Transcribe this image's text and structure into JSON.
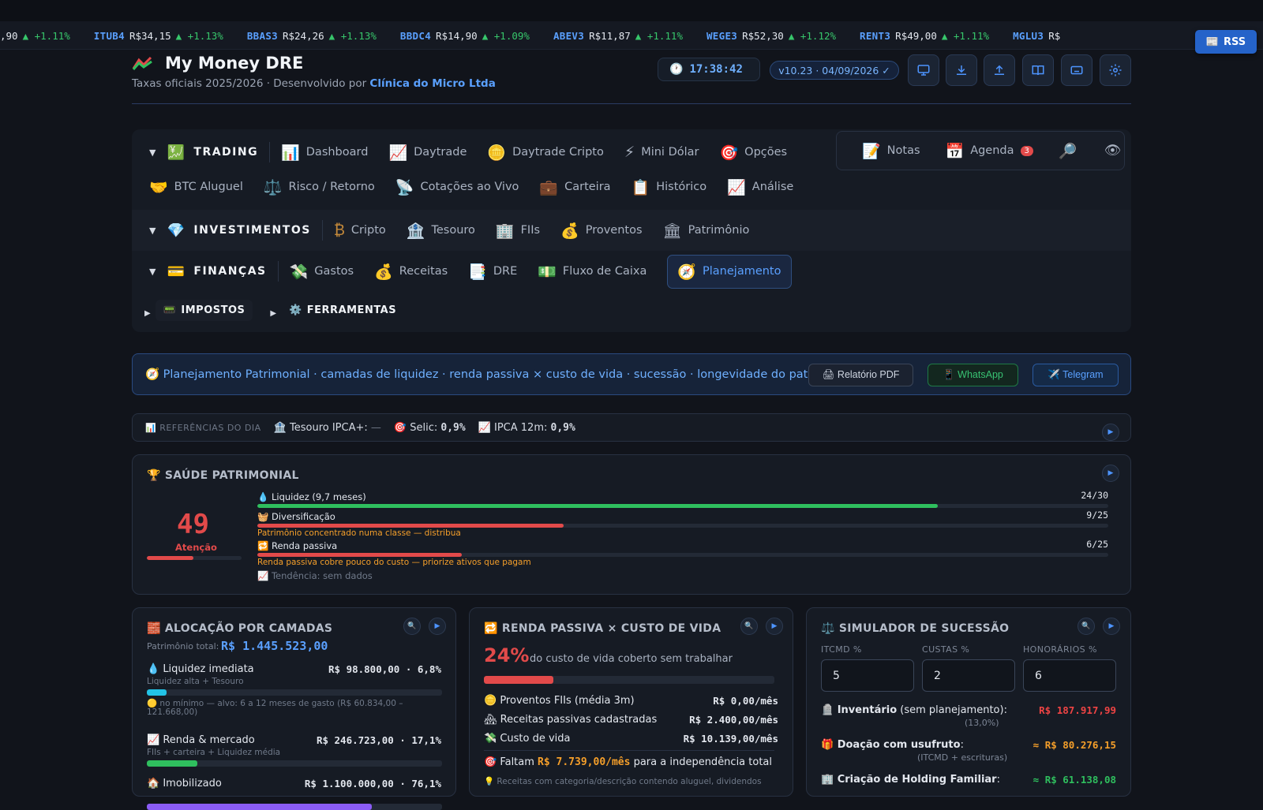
{
  "ticker": [
    {
      "sym": "",
      "price": ",90",
      "change": "▲ +1.11%"
    },
    {
      "sym": "ITUB4",
      "price": "R$34,15",
      "change": "▲ +1.13%"
    },
    {
      "sym": "BBAS3",
      "price": "R$24,26",
      "change": "▲ +1.13%"
    },
    {
      "sym": "BBDC4",
      "price": "R$14,90",
      "change": "▲ +1.09%"
    },
    {
      "sym": "ABEV3",
      "price": "R$11,87",
      "change": "▲ +1.11%"
    },
    {
      "sym": "WEGE3",
      "price": "R$52,30",
      "change": "▲ +1.12%"
    },
    {
      "sym": "RENT3",
      "price": "R$49,00",
      "change": "▲ +1.11%"
    },
    {
      "sym": "MGLU3",
      "price": "R$",
      "change": ""
    }
  ],
  "rss_label": "RSS",
  "header": {
    "title": "My Money DRE",
    "subtitle_prefix": "Taxas oficiais 2025/2026 · Desenvolvido por ",
    "subtitle_company": "Clínica do Micro Ltda",
    "clock": "17:38:42",
    "version": "v10.23 · 04/09/2026 ✓"
  },
  "nav": {
    "trading": {
      "label": "TRADING",
      "items": [
        "Dashboard",
        "Daytrade",
        "Daytrade Cripto",
        "Mini Dólar",
        "Opções",
        "BTC Aluguel",
        "Risco / Retorno",
        "Cotações ao Vivo",
        "Carteira",
        "Histórico",
        "Análise"
      ]
    },
    "investimentos": {
      "label": "INVESTIMENTOS",
      "items": [
        "Cripto",
        "Tesouro",
        "FIIs",
        "Proventos",
        "Patrimônio"
      ]
    },
    "financas": {
      "label": "FINANÇAS",
      "items": [
        "Gastos",
        "Receitas",
        "DRE",
        "Fluxo de Caixa",
        "Planejamento"
      ]
    },
    "impostos": "IMPOSTOS",
    "ferramentas": "FERRAMENTAS",
    "quick": {
      "notas": "Notas",
      "agenda": "Agenda",
      "agenda_badge": "3"
    }
  },
  "banner": {
    "text": "🧭 Planejamento Patrimonial · camadas de liquidez · renda passiva × custo de vida · sucessão · longevidade do patrimônio",
    "pdf": "🖨 Relatório PDF",
    "whatsapp": "📱 WhatsApp",
    "telegram": "✈️ Telegram"
  },
  "refs": {
    "label": "📊 REFERÊNCIAS DO DIA",
    "tesouro_label": "🏦 Tesouro IPCA+:",
    "tesouro_value": "—",
    "selic_label": "🎯 Selic:",
    "selic_value": "0,9%",
    "ipca_label": "📈 IPCA 12m:",
    "ipca_value": "0,9%"
  },
  "health": {
    "title": "🏆 SAÚDE PATRIMONIAL",
    "score": "49",
    "score_label": "Atenção",
    "score_fraction": 0.49,
    "rows": [
      {
        "label": "💧 Liquidez (9,7 meses)",
        "value": "24/30",
        "fraction": 0.8,
        "color": "#2fbf5e",
        "warn": ""
      },
      {
        "label": "🧺 Diversificação",
        "value": "9/25",
        "fraction": 0.36,
        "color": "#e24a4a",
        "warn": "Patrimônio concentrado numa classe — distribua"
      },
      {
        "label": "🔁 Renda passiva",
        "value": "6/25",
        "fraction": 0.24,
        "color": "#e24a4a",
        "warn": "Renda passiva cobre pouco do custo — priorize ativos que pagam"
      }
    ],
    "trend": "📈 Tendência: sem dados"
  },
  "alloc": {
    "title": "🧱 ALOCAÇÃO POR CAMADAS",
    "total_label": "Patrimônio total:",
    "total_value": "R$ 1.445.523,00",
    "layers": [
      {
        "name": "💧 Liquidez imediata",
        "value": "R$ 98.800,00 · 6,8%",
        "sub": "Liquidez alta + Tesouro",
        "fraction": 0.068,
        "color": "#22c3e6",
        "note": "🟡 no mínimo — alvo: 6 a 12 meses de gasto (R$ 60.834,00 – 121.668,00)"
      },
      {
        "name": "📈 Renda & mercado",
        "value": "R$ 246.723,00 · 17,1%",
        "sub": "FIIs + carteira + Liquidez média",
        "fraction": 0.171,
        "color": "#2fbf5e",
        "note": ""
      },
      {
        "name": "🏠 Imobilizado",
        "value": "R$ 1.100.000,00 · 76,1%",
        "sub": "",
        "fraction": 0.761,
        "color": "#8b5cf6",
        "note": ""
      }
    ]
  },
  "renda": {
    "title": "🔁 RENDA PASSIVA × CUSTO DE VIDA",
    "pct": "24%",
    "pct_text": "do custo de vida coberto sem trabalhar",
    "fraction": 0.24,
    "rows": [
      {
        "label": "🪙 Proventos FIIs (média 3m)",
        "value": "R$ 0,00/mês"
      },
      {
        "label": "🏘 Receitas passivas cadastradas",
        "value": "R$ 2.400,00/mês"
      },
      {
        "label": "💸 Custo de vida",
        "value": "R$ 10.139,00/mês"
      }
    ],
    "faltam_prefix": "🎯 Faltam ",
    "faltam_value": "R$ 7.739,00/mês",
    "faltam_suffix": " para a independência total",
    "footnote": "💡 Receitas com categoria/descrição contendo aluguel, dividendos"
  },
  "sucessao": {
    "title": "⚖️ SIMULADOR DE SUCESSÃO",
    "fields": [
      {
        "label": "ITCMD %",
        "value": "5"
      },
      {
        "label": "CUSTAS %",
        "value": "2"
      },
      {
        "label": "HONORÁRIOS %",
        "value": "6"
      }
    ],
    "rows": [
      {
        "label": "🪦 Inventário",
        "label_rest": " (sem planejamento):",
        "value": "R$ 187.917,99",
        "color": "#ef4444",
        "sub": "(13,0%)"
      },
      {
        "label": "🎁 Doação com usufruto",
        "label_rest": ":",
        "value": "≈ R$ 80.276,15",
        "color": "#f59f2a",
        "sub": "(ITCMD + escrituras)"
      },
      {
        "label": "🏢 Criação de Holding Familiar",
        "label_rest": ":",
        "value": "≈ R$ 61.138,08",
        "color": "#2fbf5e",
        "sub": ""
      }
    ]
  }
}
